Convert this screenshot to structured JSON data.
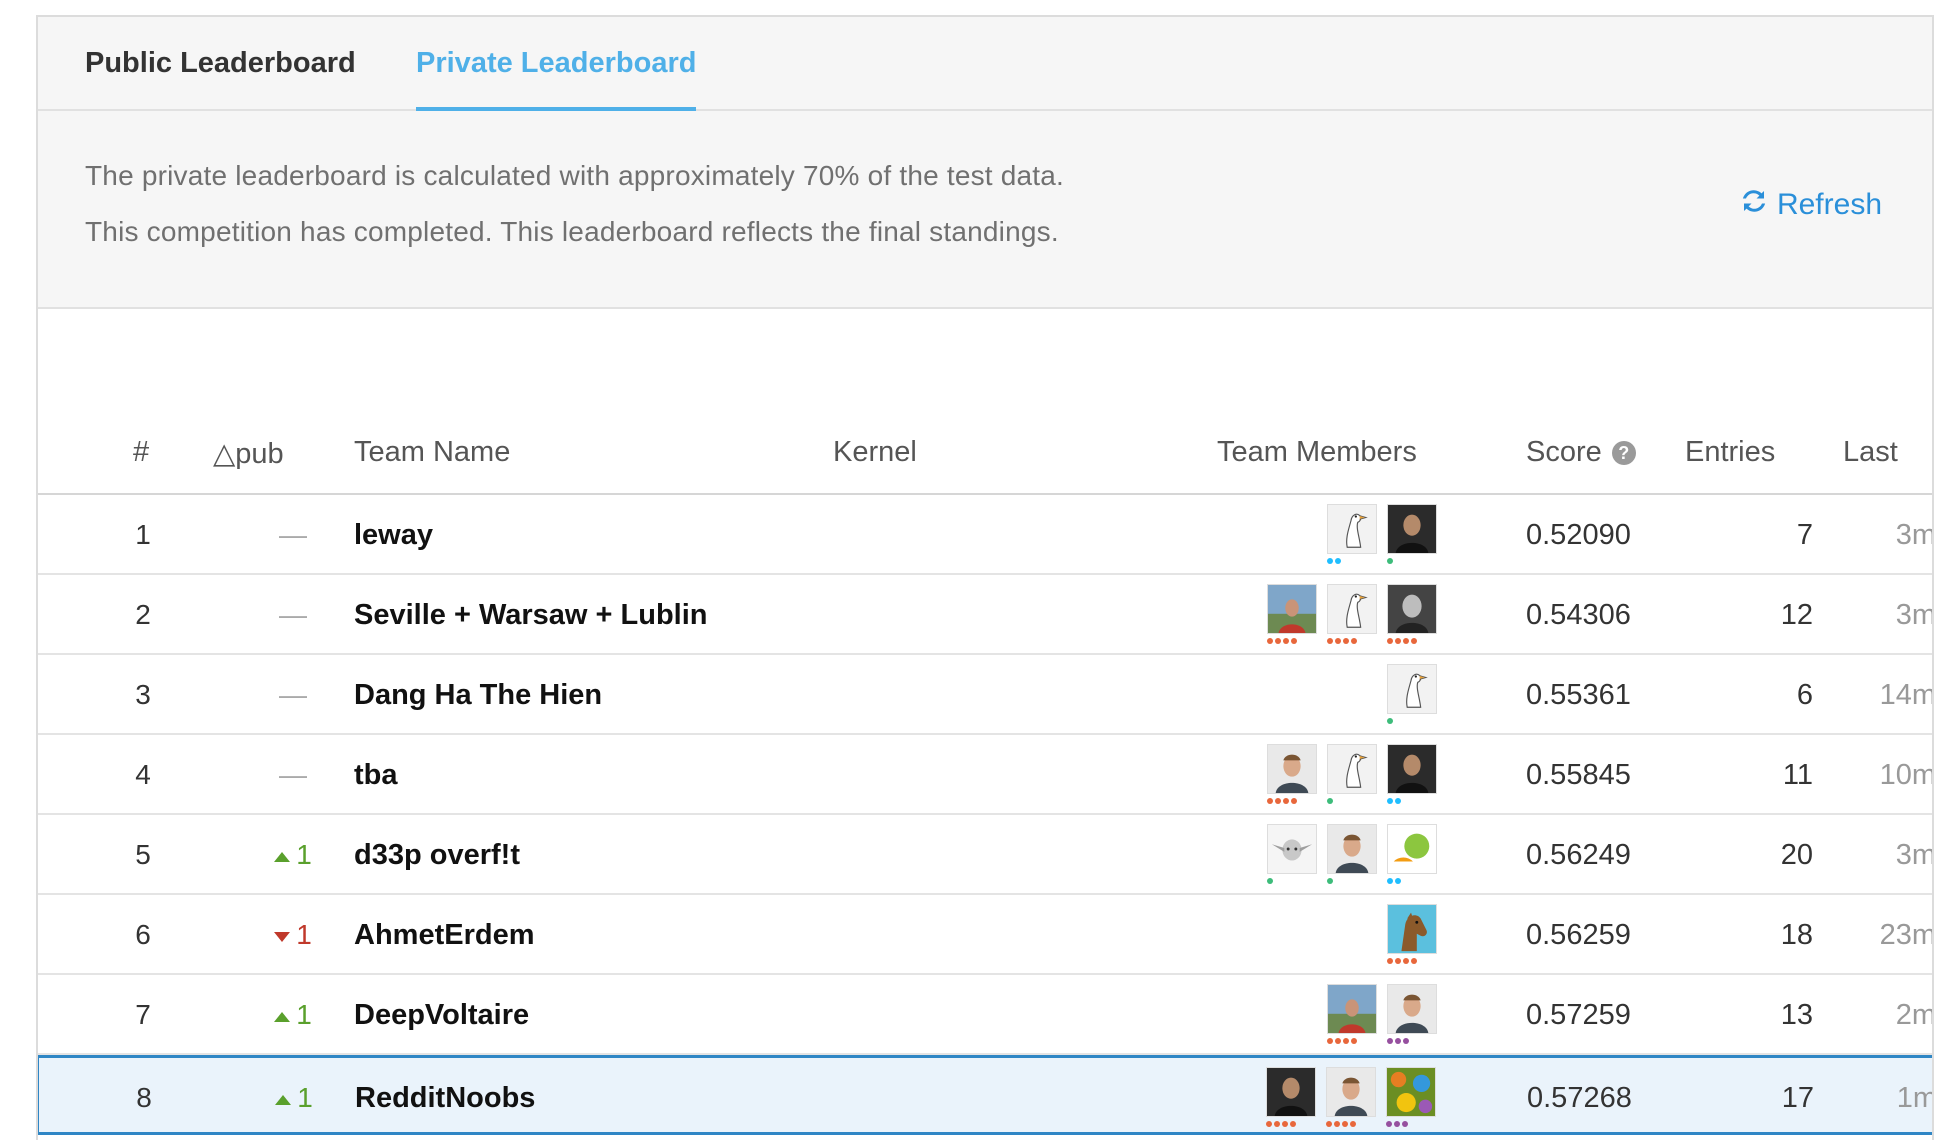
{
  "tabs": [
    {
      "label": "Public Leaderboard",
      "active": false
    },
    {
      "label": "Private Leaderboard",
      "active": true
    }
  ],
  "info": {
    "line1": "The private leaderboard is calculated with approximately 70% of the test data.",
    "line2": "This competition has completed. This leaderboard reflects the final standings.",
    "refresh_label": "Refresh",
    "refresh_icon": "refresh-icon"
  },
  "columns": {
    "rank": "#",
    "delta": "△pub",
    "team": "Team Name",
    "kernel": "Kernel",
    "members": "Team Members",
    "score": "Score",
    "entries": "Entries",
    "last": "Last"
  },
  "tier_colors": {
    "orange": "#e8673c",
    "teal": "#20beff",
    "green": "#3dbc7a",
    "purple": "#96509f"
  },
  "rows": [
    {
      "rank": "1",
      "delta": "—",
      "delta_dir": "none",
      "team": "leway",
      "score": "0.52090",
      "entries": "7",
      "last": "3m",
      "members": [
        {
          "avatar": "goose-avatar",
          "tier": "teal",
          "dots": 2
        },
        {
          "avatar": "person-avatar-dark",
          "tier": "green",
          "dots": 1
        }
      ]
    },
    {
      "rank": "2",
      "delta": "—",
      "delta_dir": "none",
      "team": "Seville + Warsaw + Lublin",
      "score": "0.54306",
      "entries": "12",
      "last": "3m",
      "members": [
        {
          "avatar": "person-avatar-outdoor",
          "tier": "orange",
          "dots": 4
        },
        {
          "avatar": "goose-avatar",
          "tier": "orange",
          "dots": 4
        },
        {
          "avatar": "person-avatar-bw",
          "tier": "orange",
          "dots": 4
        }
      ]
    },
    {
      "rank": "3",
      "delta": "—",
      "delta_dir": "none",
      "team": "Dang Ha The Hien",
      "score": "0.55361",
      "entries": "6",
      "last": "14m",
      "members": [
        {
          "avatar": "goose-avatar",
          "tier": "green",
          "dots": 1
        }
      ]
    },
    {
      "rank": "4",
      "delta": "—",
      "delta_dir": "none",
      "team": "tba",
      "score": "0.55845",
      "entries": "11",
      "last": "10m",
      "members": [
        {
          "avatar": "person-avatar-light",
          "tier": "orange",
          "dots": 4
        },
        {
          "avatar": "goose-avatar",
          "tier": "green",
          "dots": 1
        },
        {
          "avatar": "person-avatar-dark",
          "tier": "teal",
          "dots": 2
        }
      ]
    },
    {
      "rank": "5",
      "delta": "1",
      "delta_dir": "up",
      "team": "d33p overf!t",
      "score": "0.56249",
      "entries": "20",
      "last": "3m",
      "members": [
        {
          "avatar": "yoda-avatar",
          "tier": "green",
          "dots": 1
        },
        {
          "avatar": "person-avatar-light",
          "tier": "green",
          "dots": 1
        },
        {
          "avatar": "fruit-avatar",
          "tier": "teal",
          "dots": 2
        }
      ]
    },
    {
      "rank": "6",
      "delta": "1",
      "delta_dir": "down",
      "team": "AhmetErdem",
      "score": "0.56259",
      "entries": "18",
      "last": "23m",
      "members": [
        {
          "avatar": "horse-avatar",
          "tier": "orange",
          "dots": 4
        }
      ]
    },
    {
      "rank": "7",
      "delta": "1",
      "delta_dir": "up",
      "team": "DeepVoltaire",
      "score": "0.57259",
      "entries": "13",
      "last": "2m",
      "members": [
        {
          "avatar": "person-avatar-outdoor",
          "tier": "orange",
          "dots": 4
        },
        {
          "avatar": "person-avatar-light",
          "tier": "purple",
          "dots": 3
        }
      ]
    },
    {
      "rank": "8",
      "delta": "1",
      "delta_dir": "up",
      "team": "RedditNoobs",
      "score": "0.57268",
      "entries": "17",
      "last": "1m",
      "highlight": true,
      "members": [
        {
          "avatar": "person-avatar-dark",
          "tier": "orange",
          "dots": 4
        },
        {
          "avatar": "person-avatar-light",
          "tier": "orange",
          "dots": 4
        },
        {
          "avatar": "pattern-avatar",
          "tier": "purple",
          "dots": 3
        }
      ]
    }
  ]
}
